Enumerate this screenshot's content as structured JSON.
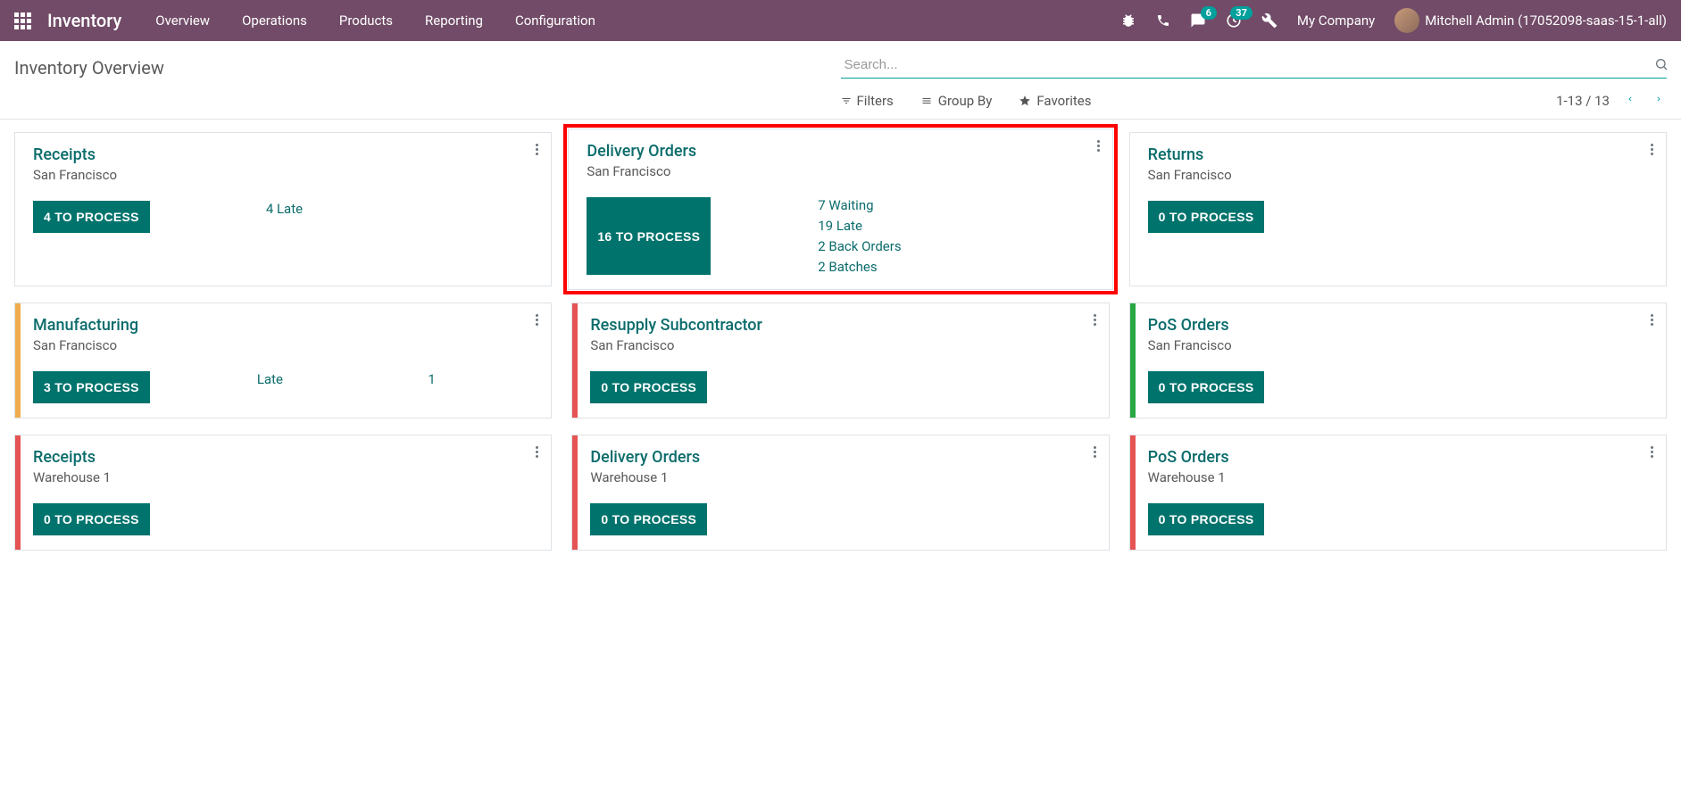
{
  "navbar": {
    "brand": "Inventory",
    "menu": [
      "Overview",
      "Operations",
      "Products",
      "Reporting",
      "Configuration"
    ],
    "msg_badge": "6",
    "clock_badge": "37",
    "company": "My Company",
    "user": "Mitchell Admin (17052098-saas-15-1-all)"
  },
  "control": {
    "title": "Inventory Overview",
    "search_placeholder": "Search...",
    "filters": "Filters",
    "groupby": "Group By",
    "favorites": "Favorites",
    "pager": "1-13 / 13"
  },
  "cards": [
    {
      "title": "Receipts",
      "sub": "San Francisco",
      "bar": "bar-none",
      "button": "4 TO PROCESS",
      "statuses_inline": [
        {
          "label": "4 Late"
        }
      ]
    },
    {
      "title": "Delivery Orders",
      "sub": "San Francisco",
      "bar": "bar-none",
      "button": "16 TO PROCESS",
      "highlight": true,
      "statuses_list": [
        "7 Waiting",
        "19 Late",
        "2 Back Orders",
        "2 Batches"
      ]
    },
    {
      "title": "Returns",
      "sub": "San Francisco",
      "bar": "bar-none",
      "button": "0 TO PROCESS"
    },
    {
      "title": "Manufacturing",
      "sub": "San Francisco",
      "bar": "bar-orange",
      "button": "3 TO PROCESS",
      "statuses_row": {
        "label": "Late",
        "count": "1"
      }
    },
    {
      "title": "Resupply Subcontractor",
      "sub": "San Francisco",
      "bar": "bar-red",
      "button": "0 TO PROCESS"
    },
    {
      "title": "PoS Orders",
      "sub": "San Francisco",
      "bar": "bar-green",
      "button": "0 TO PROCESS"
    },
    {
      "title": "Receipts",
      "sub": "Warehouse 1",
      "bar": "bar-red",
      "button": "0 TO PROCESS"
    },
    {
      "title": "Delivery Orders",
      "sub": "Warehouse 1",
      "bar": "bar-red",
      "button": "0 TO PROCESS"
    },
    {
      "title": "PoS Orders",
      "sub": "Warehouse 1",
      "bar": "bar-red",
      "button": "0 TO PROCESS"
    }
  ]
}
